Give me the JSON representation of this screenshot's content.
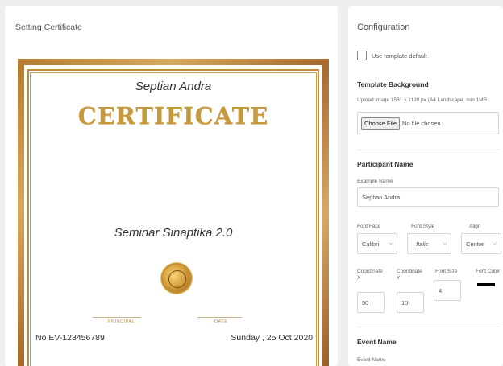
{
  "left": {
    "title": "Setting Certificate",
    "certificate": {
      "participant_name": "Septian Andra",
      "heading": "CERTIFICATE",
      "event_name": "Seminar Sinaptika 2.0",
      "signature_labels": [
        "PRINCIPAL",
        "DATE"
      ],
      "number": "No EV-123456789",
      "date": "Sunday , 25 Oct 2020"
    }
  },
  "config": {
    "title": "Configuration",
    "use_template_label": "Use template default",
    "template_background": {
      "title": "Template Background",
      "hint": "Upload image 1581 x 1190 px (A4 Landscape) min 1MB",
      "choose_file": "Choose File",
      "no_file": "No file chosen"
    },
    "participant": {
      "title": "Participant Name",
      "example_label": "Example Name",
      "example_value": "Septian Andra",
      "font_face_label": "Font Face",
      "font_face_value": "Calibri",
      "font_style_label": "Font Style",
      "font_style_value": "Italic",
      "align_label": "Align",
      "align_value": "Center",
      "coord_x_label": "Coordinate X",
      "coord_x_value": "50",
      "coord_y_label": "Coordinate Y",
      "coord_y_value": "10",
      "font_size_label": "Font Size",
      "font_size_value": "4",
      "font_color_label": "Font Color",
      "font_color_value": "#000000"
    },
    "event": {
      "title": "Event Name",
      "example_label": "Event Name"
    }
  }
}
